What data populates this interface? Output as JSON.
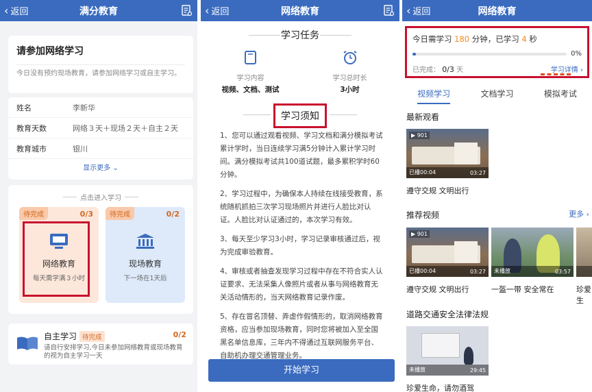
{
  "panel1": {
    "nav": {
      "back": "返回",
      "title": "满分教育"
    },
    "intro": {
      "title": "请参加网络学习",
      "desc": "今日没有预约现场教育，请参加网络学习或自主学习。"
    },
    "info": [
      {
        "key": "姓名",
        "value": "李新华"
      },
      {
        "key": "教育天数",
        "value": "网络３天＋现场２天＋自主２天"
      },
      {
        "key": "教育城市",
        "value": "银川"
      }
    ],
    "show_more": "显示更多",
    "enter_header": "点击进入学习",
    "tiles": [
      {
        "badge": "待完成",
        "count": "0/3",
        "name": "网络教育",
        "sub": "每天需学满３小时"
      },
      {
        "badge": "待完成",
        "count": "0/2",
        "name": "现场教育",
        "sub": "下一场在1天后"
      }
    ],
    "self": {
      "title": "自主学习",
      "badge": "待完成",
      "count": "0/2",
      "desc": "请自行安排学习,今日未参加网络教育或现场教育的视为自主学习一天"
    }
  },
  "panel2": {
    "nav": {
      "back": "返回",
      "title": "网络教育"
    },
    "task_title": "学习任务",
    "tasks": [
      {
        "label": "学习内容",
        "value": "视频、文档、测试"
      },
      {
        "label": "学习总时长",
        "value": "3小时"
      }
    ],
    "notice_title": "学习须知",
    "rules": [
      "1、您可以通过观看视频、学习文档和满分模拟考试累计学时，当日连续学习满5分钟计入累计学习时间。满分模拟考试共100道试题，最多累积学时60分钟。",
      "2、学习过程中，为确保本人持续在线接受教育，系统随机抓拍三次学习现场照片并进行人脸比对认证。人脸比对认证通过的，本次学习有效。",
      "3、每天至少学习3小时，学习记录审核通过后，视为完成审验教育。",
      "4、审核或者抽查发现学习过程中存在不符合实人认证要求、无法采集人像照片或者从事与网络教育无关活动情形的，当天网络教育记录作废。",
      "5、存在冒名顶替、弄虚作假情形的，取消网络教育资格，应当参加现场教育，同时您将被加入至全国黑名单信息库，三年内不得通过互联网服务平台、自助机办理交通管理业务。"
    ],
    "start_button": "开始学习"
  },
  "panel3": {
    "nav": {
      "back": "返回",
      "title": "网络教育"
    },
    "progress": {
      "prefix": "今日需学习",
      "need": "180",
      "mid": "分钟，已学习",
      "learned": "4",
      "suffix": "秒",
      "percent_text": "0%",
      "percent": 0.02,
      "done_label": "已完成：",
      "done_value": "0/3",
      "done_unit": "天",
      "detail": "学习详情"
    },
    "tabs": [
      "视频学习",
      "文档学习",
      "模拟考试"
    ],
    "recent_title": "最新观看",
    "recent": [
      {
        "count": "901",
        "watched": "已播00:04",
        "duration": "03:27",
        "title": "遵守交规 文明出行"
      }
    ],
    "recommend_title": "推荐视频",
    "more": "更多",
    "recommend": [
      {
        "count": "901",
        "watched": "已播00:04",
        "duration": "03:27",
        "title": "遵守交规 文明出行"
      },
      {
        "count": "",
        "watched": "未播放",
        "duration": "03:57",
        "title": "一盔一带 安全常在"
      },
      {
        "count": "",
        "watched": "",
        "duration": "",
        "title": "珍爱生"
      }
    ],
    "law_title": "道路交通安全法律法规",
    "law": [
      {
        "watched": "未播放",
        "duration": "29:45",
        "title": "珍爱生命，请勿酒驾"
      }
    ]
  },
  "colors": {
    "primary": "#3a6bbf",
    "orange": "#f08a24",
    "highlight": "#c8102e"
  }
}
